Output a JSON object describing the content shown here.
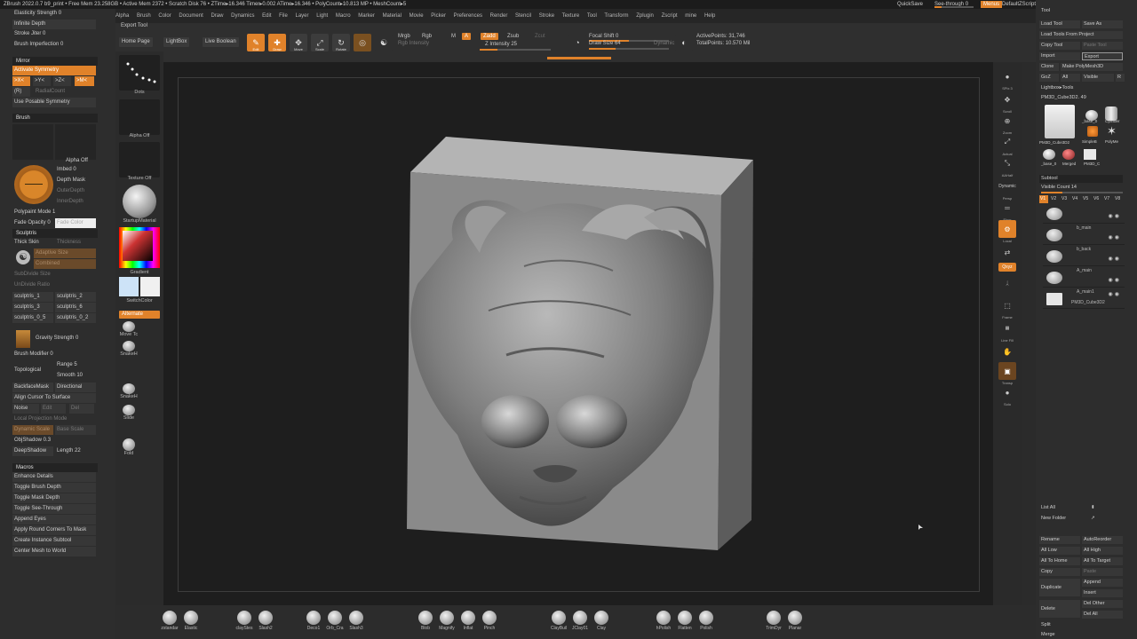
{
  "titlebar": {
    "text": "ZBrush 2022.0.7    b9_print    • Free Mem 23.258GB • Active Mem 2372 • Scratch Disk 76 • ZTime▸16.346 Timer▸0.002 ATime▸16.346 • PolyCount▸10.813 MP • MeshCount▸5",
    "quicksave": "QuickSave",
    "see_through": "See-through 0",
    "menus": "Menus",
    "default_script": "DefaultZScript",
    "controls": "– □ ×"
  },
  "menubar": [
    "Alpha",
    "Brush",
    "Color",
    "Document",
    "Draw",
    "Dynamics",
    "Edit",
    "File",
    "Layer",
    "Light",
    "Macro",
    "Marker",
    "Material",
    "Movie",
    "Picker",
    "Preferences",
    "Render",
    "Stencil",
    "Stroke",
    "Texture",
    "Tool",
    "Transform",
    "Zplugin",
    "Zscript",
    "mine",
    "Help"
  ],
  "toolbar": {
    "export_tool": "Export Tool",
    "home_page": "Home Page",
    "lightbox": "LightBox",
    "live_boolean": "Live Boolean",
    "edit": "Edit",
    "draw": "Draw",
    "move": "Move",
    "scale": "Scale",
    "rotate": "Rotate",
    "mrgb": "Mrgb",
    "rgb": "Rgb",
    "m": "M",
    "rgb_intensity": "Rgb Intensity",
    "a_btn": "A",
    "zadd": "Zadd",
    "zsub": "Zsub",
    "zcut": "Zcut",
    "z_intensity": "Z Intensity 25",
    "focal_shift": "Focal Shift 0",
    "draw_size": "Draw Size 64",
    "dynamic": "Dynamic",
    "active_points": "ActivePoints: 31,746",
    "total_points": "TotalPoints: 10.570 Mil"
  },
  "leftpanel": {
    "top_items": [
      "Elasticity Strength 0",
      "Infinite Depth",
      "Stroke Jiter 0",
      "Brush Imperfection 0"
    ],
    "mirror_title": "Mirror",
    "activate_symmetry": "Activate Symmetry",
    "axes": [
      ">X<",
      ">Y<",
      ">Z<",
      ">M<"
    ],
    "radial_r": "(R)",
    "radial_count": "RadialCount",
    "use_posable": "Use Posable Symmetry",
    "brush_title": "Brush",
    "alpha_off_label": "Alpha Off",
    "imbed": "Imbed 0",
    "depth_mask": "Depth Mask",
    "outer_depth": "OuterDepth",
    "inner_depth": "InnerDepth",
    "polypaint_mode": "Polypaint Mode 1",
    "fade_opacity": "Fade Opacity 0",
    "fade_color": "Fade Color",
    "sculptris_title": "Sculptris",
    "thick_skin": "Thick Skin",
    "thickness": "Thickness",
    "adaptive_size": "Adaptive Size",
    "combined": "Combined",
    "subdivide_size": "SubDivide Size",
    "undivide_ratio": "UnDivide Ratio",
    "sculptris_buttons": [
      "sculptris_1",
      "sculptris_2",
      "sculptris_3",
      "sculptris_6",
      "sculptris_0_5",
      "sculptris_0_2"
    ],
    "gravity_strength": "Gravity Strength 0",
    "brush_modifier": "Brush Modifier 0",
    "topological": "Topological",
    "range": "Range 5",
    "smooth": "Smooth 10",
    "backface_mask": "BackfaceMask",
    "directional": "Directional",
    "align_cursor": "Align Cursor To Surface",
    "noise": "Noise",
    "edit": "Edit",
    "del": "Del",
    "local_projection": "Local Projection Mode",
    "dynamic_scale": "Dynamic Scale",
    "base_scale": "Base Scale",
    "objshadow": "ObjShadow 0.3",
    "deepshadow": "DeepShadow",
    "length": "Length 22",
    "macros_title": "Macros",
    "macros": [
      "Enhance Details",
      "Toggle Brush Depth",
      "Toggle Mask Depth",
      "Toggle See-Through",
      "Append Eyes",
      "Apply Round Corners To Mask",
      "Create Instance Subtool",
      "Center Mesh to World"
    ]
  },
  "palette2": {
    "dots": "Dots",
    "alpha_off": "Alpha Off",
    "texture_off": "Texture Off",
    "startup_material": "StartupMaterial",
    "gradient": "Gradient",
    "switch_color": "SwitchColor",
    "alternate": "Alternate",
    "move_tool": "Move Tc",
    "snakehook": "SnakeH",
    "snakehook2": "SnakeH",
    "slide": "Slide",
    "fold": "Fold"
  },
  "rightstrip": [
    "SPix 3",
    "Scroll",
    "Zoom",
    "Actual",
    "AAHalf",
    "Dynamic",
    "Persp",
    "Floor",
    "Local",
    "L.Sym",
    "Qxyz",
    "",
    "Frame",
    "Line Fill",
    "Move",
    "",
    "Transp",
    "Solo"
  ],
  "rightpanel": {
    "tool_title": "Tool",
    "load_tool": "Load Tool",
    "save_as": "Save As",
    "load_from_project": "Load Tools From Project",
    "copy_tool": "Copy Tool",
    "paste_tool": "Paste Tool",
    "import": "Import",
    "export": "Export",
    "clone": "Clone",
    "make_polymesh": "Make PolyMesh3D",
    "goz": "GoZ",
    "all": "All",
    "visible": "Visible",
    "r": "R",
    "lightbox_tools": "Lightbox▸Tools",
    "current_tool": "PM3D_Cube3D2. 49",
    "tool_thumbs": [
      "PM3D_Cube3D2",
      "_base_0",
      "Cylinder",
      "SimpleB",
      "PolyMe",
      "_base_0",
      "Merged",
      "PM3D_C"
    ],
    "subtool_title": "Subtool",
    "visible_count": "Visible Count 14",
    "versions": [
      "V1",
      "V2",
      "V3",
      "V4",
      "V5",
      "V6",
      "V7",
      "V8"
    ],
    "subtools": [
      "",
      "b_main",
      "b_back",
      "A_main",
      "A_main1",
      "PM3D_Cube3D2"
    ],
    "list_all": "List All",
    "new_folder": "New Folder",
    "rename": "Rename",
    "autoreorder": "AutoReorder",
    "all_low": "All Low",
    "all_high": "All High",
    "all_to_home": "All To Home",
    "all_to_target": "All To Target",
    "copy": "Copy",
    "paste": "Paste",
    "duplicate": "Duplicate",
    "append": "Append",
    "insert": "Insert",
    "delete": "Delete",
    "del_other": "Del Other",
    "del_all": "Del All",
    "split": "Split",
    "merge": "Merge"
  },
  "bottomshelf": [
    "zstandar",
    "Elastic",
    "clayStes",
    "Slash2",
    "Deco1",
    "Orb_Cra",
    "Slash3",
    "Blob",
    "Magnify",
    "Inflat",
    "Pinch",
    "ClayBuil",
    "JClay01",
    "Clay",
    "hPolish",
    "Flatten",
    "Polish",
    "TrimDyr",
    "Planar"
  ],
  "colors": {
    "accent": "#e0822a",
    "panel": "#2d2d2d",
    "viewport": "#1e1e1e"
  }
}
